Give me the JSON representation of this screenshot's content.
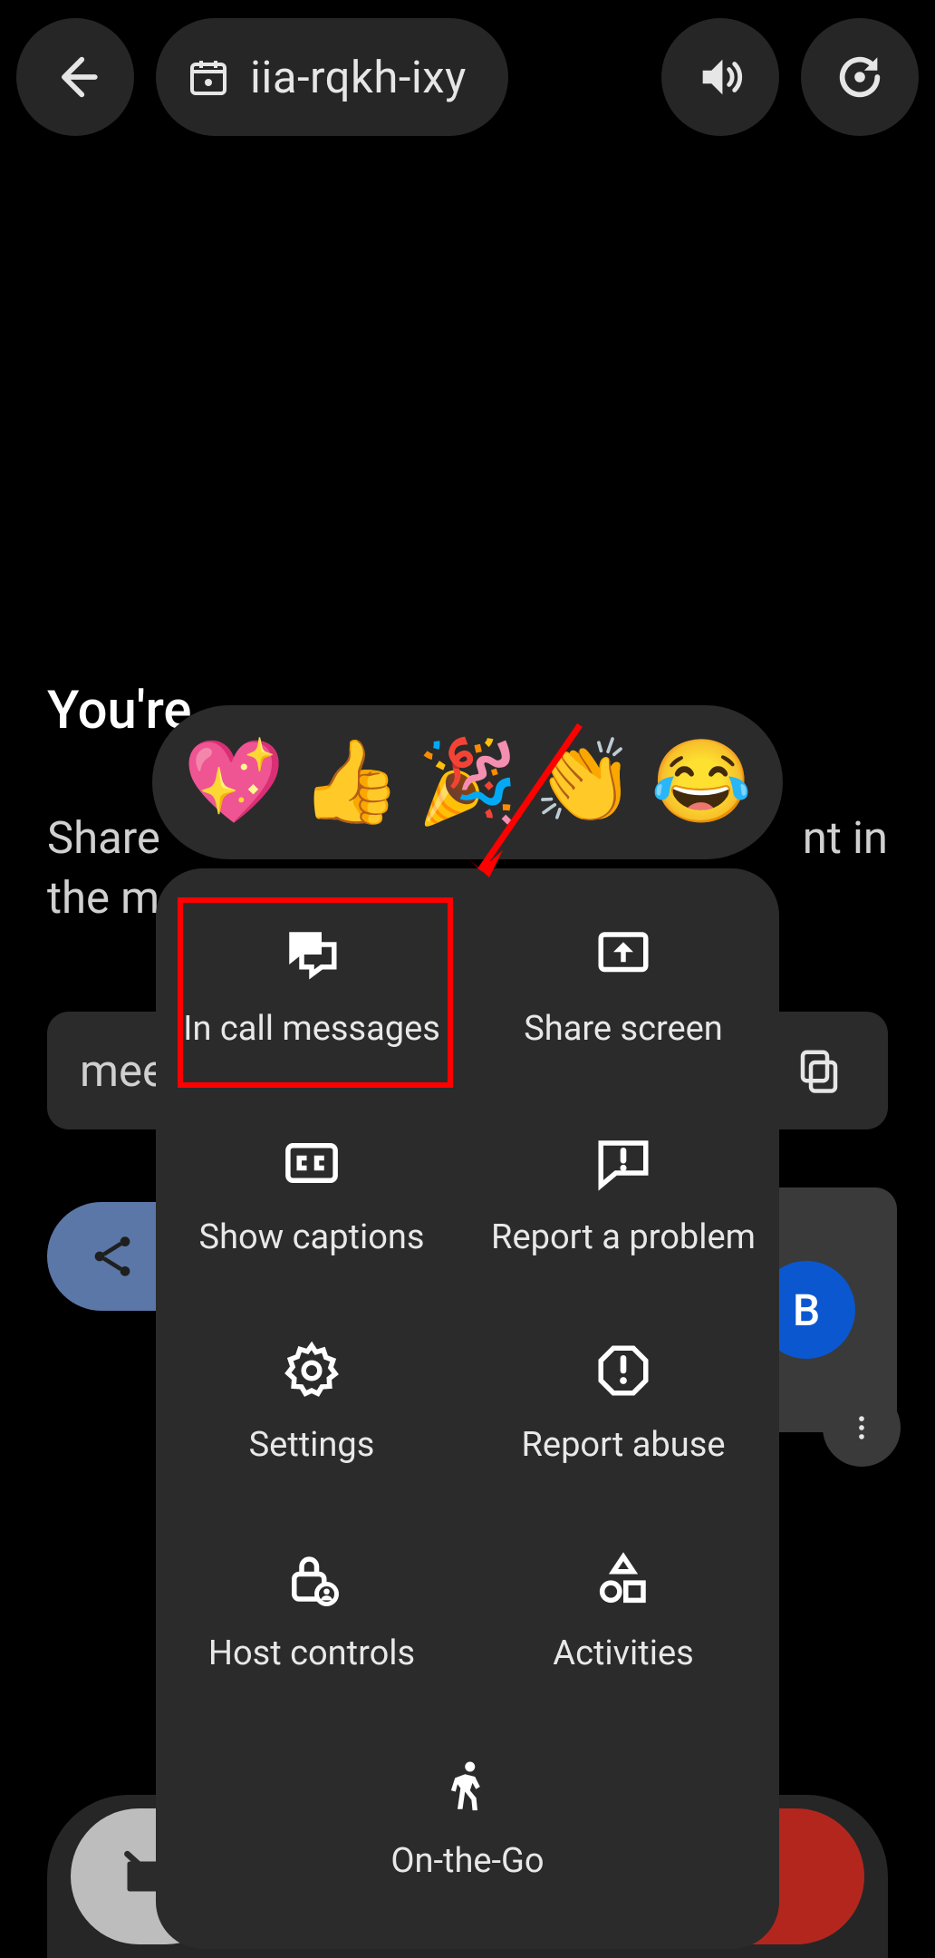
{
  "topbar": {
    "meeting_code": "iia-rqkh-ixy"
  },
  "background": {
    "heading_visible": "You're",
    "desc_line1_suffix": "nt in",
    "desc_line2": "the mee",
    "share_prefix": "Share ",
    "link_prefix": "mee"
  },
  "avatar": {
    "initial": "B"
  },
  "reactions": {
    "heart": "💖",
    "thumbs_up": "👍",
    "party": "🎉",
    "clap": "👏",
    "laugh": "😂"
  },
  "panel": {
    "in_call_messages": "In call messages",
    "share_screen": "Share screen",
    "show_captions": "Show captions",
    "report_problem": "Report a problem",
    "settings": "Settings",
    "report_abuse": "Report abuse",
    "host_controls": "Host controls",
    "activities": "Activities",
    "on_the_go": "On-the-Go"
  }
}
